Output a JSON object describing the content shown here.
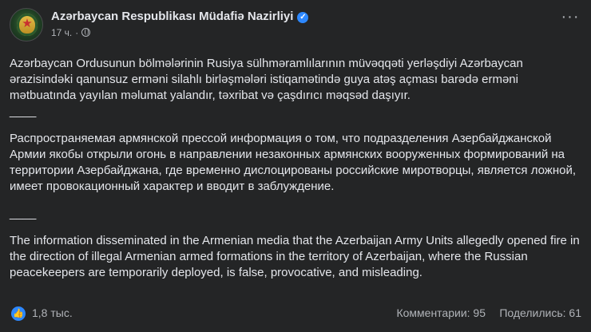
{
  "header": {
    "page_name": "Azərbaycan Respublikası Müdafiə Nazirliyi",
    "time": "17 ч.",
    "dot": "·",
    "icons": {
      "avatar": "ministry-emblem",
      "verified": "verified-badge-icon",
      "privacy": "globe-icon",
      "more": "more-icon"
    },
    "more": "···"
  },
  "post": {
    "para_az": "Azərbaycan Ordusunun bölmələrinin Rusiya sülhməramlılarının müvəqqəti yerləşdiyi Azərbaycan ərazisindəki qanunsuz erməni silahlı birləşmələri istiqamətində guya atəş açması barədə erməni mətbuatında yayılan məlumat yalandır, təxribat və çaşdırıcı məqsəd daşıyır.",
    "separator": "____",
    "para_ru": "Распространяемая армянской прессой информация о том, что подразделения Азербайджанской Армии якобы открыли огонь в направлении незаконных армянских вооруженных формирований на территории Азербайджана, где временно дислоцированы российские миротворцы, является ложной, имеет провокационный характер и вводит в заблуждение.",
    "para_en": "The information disseminated in the Armenian media that the Azerbaijan Army Units allegedly opened fire in the direction of illegal Armenian armed formations in the territory of Azerbaijan, where the Russian peacekeepers are temporarily deployed, is false, provocative, and misleading."
  },
  "footer": {
    "reactions": "1,8 тыс.",
    "comments": "Комментарии: 95",
    "shares": "Поделились: 61",
    "like_glyph": "👍"
  },
  "colors": {
    "background": "#242526",
    "text": "#e4e6eb",
    "secondary": "#b0b3b8",
    "accent": "#2d88ff"
  }
}
